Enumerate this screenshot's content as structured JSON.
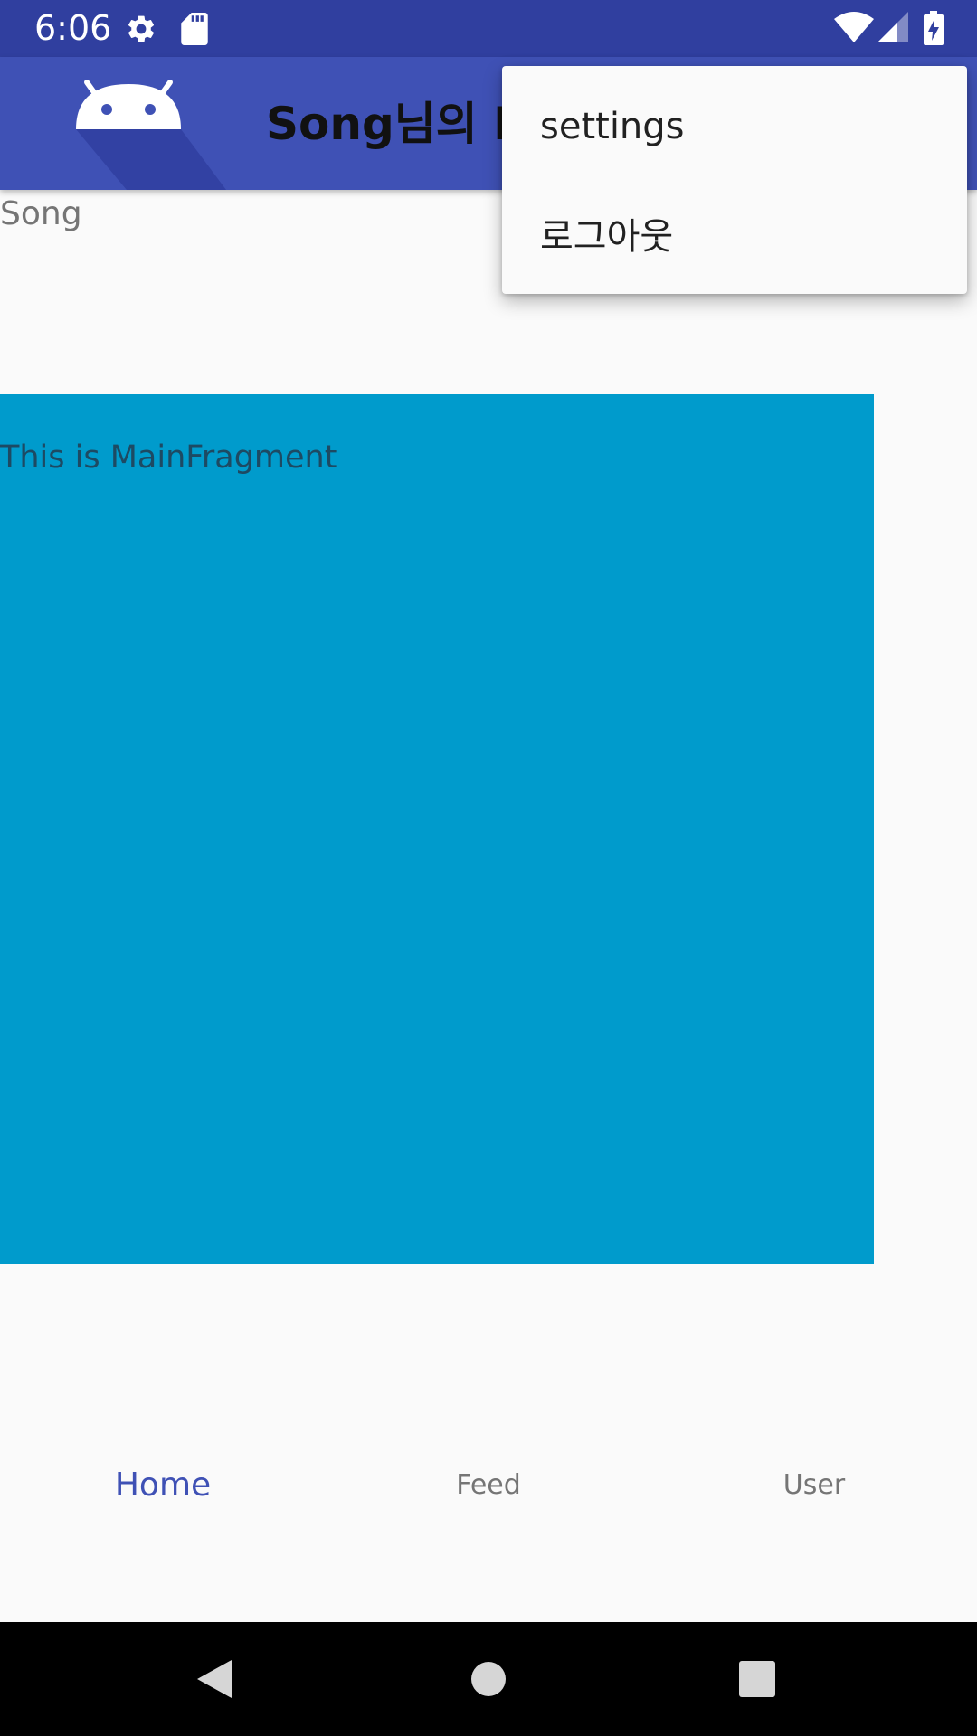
{
  "status_bar": {
    "time": "6:06",
    "left_icons": [
      "gear-icon",
      "sd-card-icon"
    ],
    "right_icons": [
      "wifi-icon",
      "cell-signal-icon",
      "battery-charging-icon"
    ],
    "color": "#303f9f"
  },
  "app_bar": {
    "title": "Song님의 In",
    "logo_icon": "android-icon",
    "color": "#3f51b5"
  },
  "content": {
    "user_label": "Song",
    "fragment_text": "This is MainFragment",
    "fragment_color": "#009bcc"
  },
  "bottom_nav": {
    "items": [
      {
        "label": "Home",
        "active": true
      },
      {
        "label": "Feed",
        "active": false
      },
      {
        "label": "User",
        "active": false
      }
    ],
    "active_color": "#3f51b5"
  },
  "overflow_menu": {
    "items": [
      {
        "label": "settings"
      },
      {
        "label": "로그아웃"
      }
    ]
  },
  "system_nav": {
    "buttons": [
      "back-icon",
      "home-circle-icon",
      "recents-icon"
    ]
  }
}
